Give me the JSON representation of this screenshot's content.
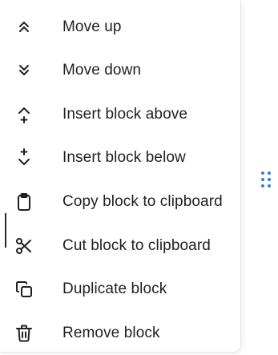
{
  "menu": {
    "items": [
      {
        "icon": "chevrons-up-icon",
        "label": "Move up"
      },
      {
        "icon": "chevrons-down-icon",
        "label": "Move down"
      },
      {
        "icon": "insert-above-icon",
        "label": "Insert block above"
      },
      {
        "icon": "insert-below-icon",
        "label": "Insert block below"
      },
      {
        "icon": "clipboard-icon",
        "label": "Copy block to clipboard"
      },
      {
        "icon": "scissors-icon",
        "label": "Cut block to clipboard"
      },
      {
        "icon": "duplicate-icon",
        "label": "Duplicate block"
      },
      {
        "icon": "trash-icon",
        "label": "Remove block"
      }
    ]
  },
  "colors": {
    "text": "#1f1f24",
    "icon": "#1f1f24",
    "handle": "#3a7fc4",
    "border": "#e6e6ea"
  },
  "drag_handle": {
    "icon": "drag-handle-icon"
  }
}
